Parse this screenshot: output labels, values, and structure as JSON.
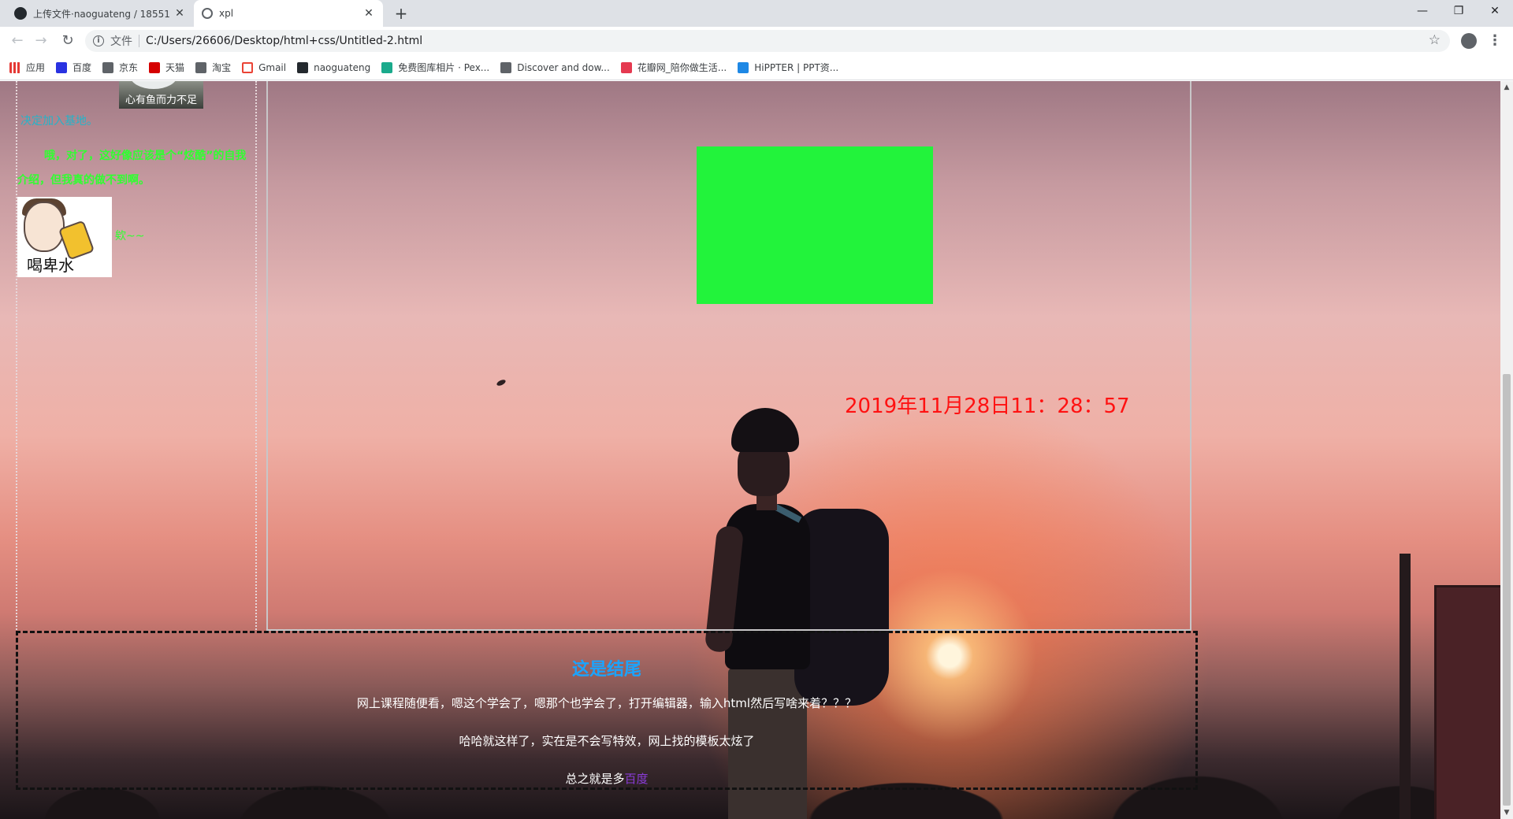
{
  "browser": {
    "tabs": [
      {
        "title": "上传文件·naoguateng / 18551",
        "close": "✕",
        "icon": "github-icon"
      },
      {
        "title": "xpl",
        "close": "✕",
        "icon": "globe-icon"
      }
    ],
    "new_tab": "+",
    "window_controls": {
      "minimize": "—",
      "maximize": "❐",
      "close": "✕"
    },
    "address": {
      "scheme_label": "文件",
      "url": "C:/Users/26606/Desktop/html+css/Untitled-2.html"
    },
    "bookmarks": [
      {
        "label": "应用",
        "icon": "apps-icon"
      },
      {
        "label": "百度",
        "icon": "baidu-icon"
      },
      {
        "label": "京东",
        "icon": "globe-icon"
      },
      {
        "label": "天猫",
        "icon": "tmall-icon"
      },
      {
        "label": "淘宝",
        "icon": "globe-icon"
      },
      {
        "label": "Gmail",
        "icon": "gmail-icon"
      },
      {
        "label": "naoguateng",
        "icon": "github-icon"
      },
      {
        "label": "免费图库相片 · Pex...",
        "icon": "pexels-icon"
      },
      {
        "label": "Discover and dow...",
        "icon": "globe-icon"
      },
      {
        "label": "花瓣网_陪你做生活...",
        "icon": "huaban-icon"
      },
      {
        "label": "HiPPTER | PPT资...",
        "icon": "hippter-icon"
      }
    ]
  },
  "page": {
    "avatar_caption": "心有鱼而力不足",
    "left_text_1": "决定加入基地。",
    "left_text_2": "哦，对了，这好像应该是个“炫酷”的自我介绍，但我真的做不到啊。",
    "drink_caption": "喝卑水",
    "left_text_3": "欸~~",
    "clock": "2019年11月28日11：28：57",
    "footer": {
      "title": "这是结尾",
      "line_1": "网上课程随便看，嗯这个学会了，嗯那个也学会了，打开编辑器，输入html然后写啥来着？？？",
      "line_2": "哈哈就这样了，实在是不会写特效，网上找的模板太炫了",
      "line_3_prefix": "总之就是多",
      "line_3_link": "百度"
    }
  },
  "colors": {
    "green_box": "#22f33b",
    "clock_text": "#ff1111",
    "footer_title": "#1aa4ff",
    "left_text_green": "#30ff30",
    "left_text_cyan": "#26b3c8"
  }
}
